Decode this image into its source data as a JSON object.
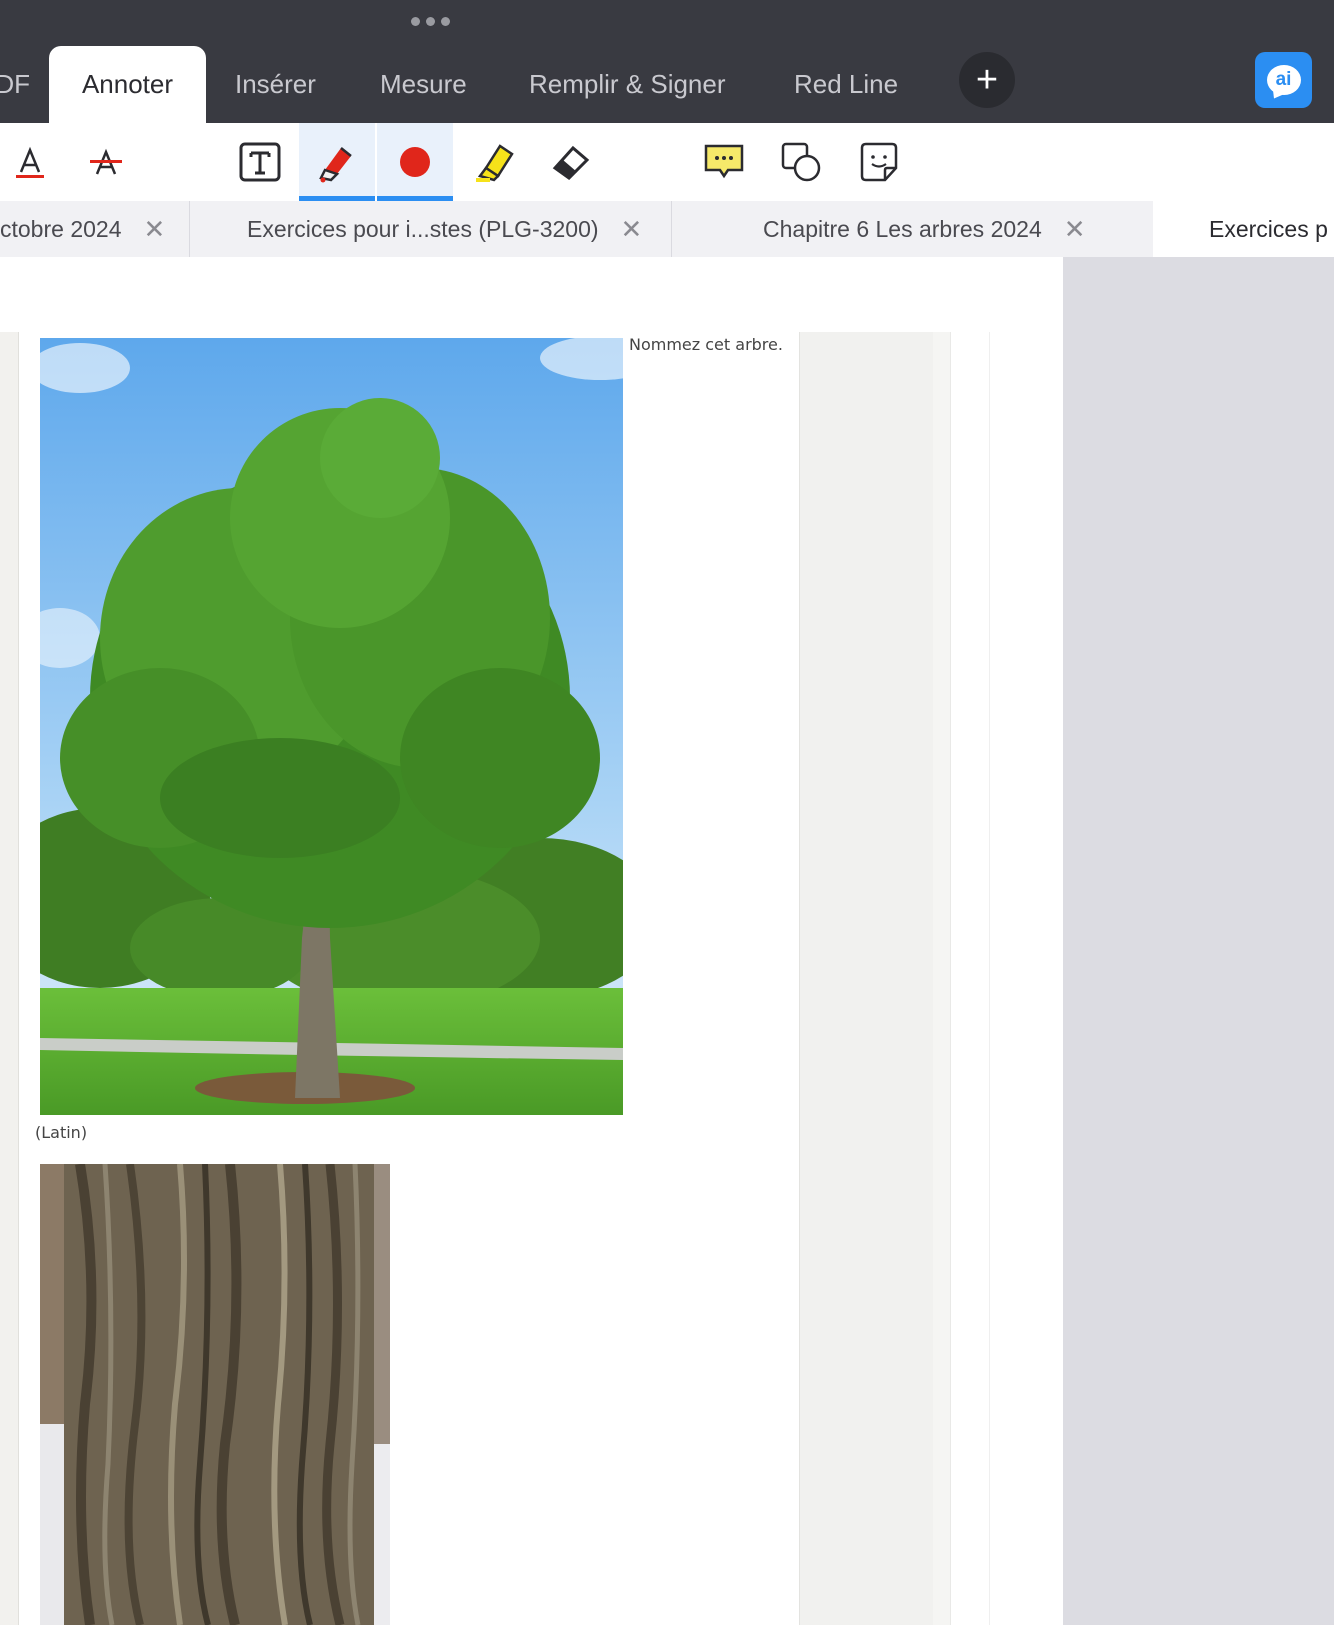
{
  "top_tabs": [
    {
      "label": "DF"
    },
    {
      "label": "Annoter"
    },
    {
      "label": "Insérer"
    },
    {
      "label": "Mesure"
    },
    {
      "label": "Remplir & Signer"
    },
    {
      "label": "Red Line"
    }
  ],
  "active_tab": "Annoter",
  "add_tab_symbol": "+",
  "ai_button_label": "ai",
  "toolbar_tools": [
    "text-color-icon",
    "strikethrough-icon",
    "text-box-icon",
    "pen-icon",
    "color-dot-icon",
    "highlighter-icon",
    "eraser-icon",
    "comment-icon",
    "shapes-icon",
    "sticker-icon"
  ],
  "selected_tool": "pen-icon",
  "colors": {
    "header": "#393a41",
    "accent": "#2b8ef2",
    "pen_color": "#e0261b",
    "highlighter": "#f6e21a"
  },
  "doc_tabs": [
    {
      "label": "ctobre 2024",
      "close": "✕"
    },
    {
      "label": "Exercices pour i...stes (PLG-3200)",
      "close": "✕"
    },
    {
      "label": "Chapitre 6 Les arbres  2024",
      "close": "✕"
    },
    {
      "label": "Exercices p"
    }
  ],
  "document": {
    "question": "Nommez cet arbre.",
    "latin_label": "(Latin)"
  }
}
